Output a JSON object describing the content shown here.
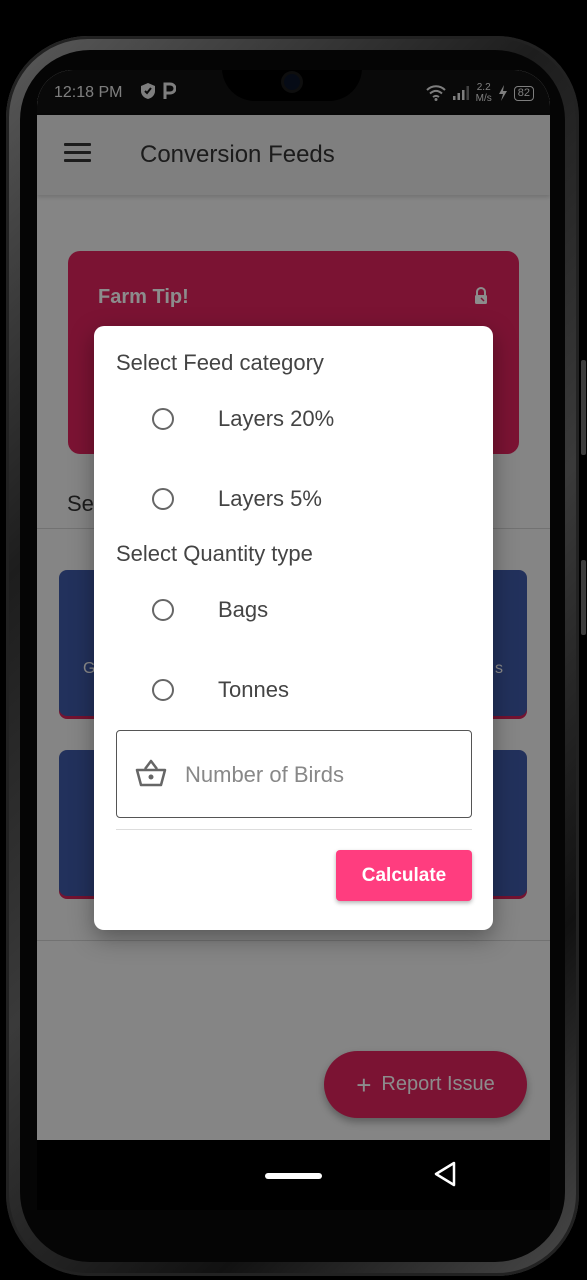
{
  "status_bar": {
    "time": "12:18 PM",
    "speed_value": "2.2",
    "speed_unit": "M/s",
    "battery": "82"
  },
  "app_bar": {
    "title": "Conversion Feeds",
    "menu_icon": "menu-icon"
  },
  "tip_card": {
    "title": "Farm Tip!",
    "icon": "lock-user-icon"
  },
  "background": {
    "section_label_partial": "Se",
    "tile_left_text_partial": "G",
    "tile_right_text_partial": "s"
  },
  "dialog": {
    "feed_heading": "Select Feed category",
    "feed_options": [
      "Layers 20%",
      "Layers 5%"
    ],
    "quantity_heading": "Select Quantity type",
    "quantity_options": [
      "Bags",
      "Tonnes"
    ],
    "birds_input": {
      "placeholder": "Number of Birds",
      "value": "",
      "icon": "basket-icon"
    },
    "calculate_label": "Calculate"
  },
  "fab": {
    "label": "Report Issue",
    "icon": "plus-icon"
  },
  "colors": {
    "accent": "#e0245e",
    "button": "#ff3d7f",
    "tile": "#3f5aa8"
  }
}
